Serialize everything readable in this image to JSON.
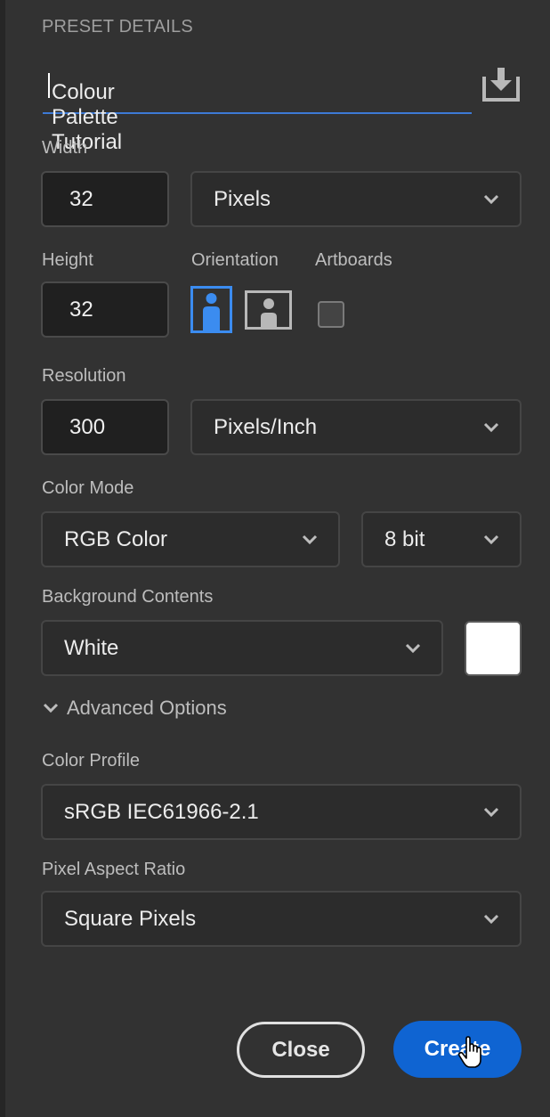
{
  "header": {
    "title": "PRESET DETAILS"
  },
  "preset_name": {
    "value": "Colour Palette Tutorial"
  },
  "icons": {
    "save_preset": "save-preset-icon",
    "portrait": "portrait-orientation-icon",
    "landscape": "landscape-orientation-icon",
    "chevron": "chevron-down-icon",
    "cursor": "hand-pointer-cursor"
  },
  "width": {
    "label": "Width",
    "value": "32",
    "unit": "Pixels"
  },
  "height": {
    "label": "Height",
    "value": "32"
  },
  "orientation": {
    "label": "Orientation",
    "selected": "portrait"
  },
  "artboards": {
    "label": "Artboards",
    "checked": false
  },
  "resolution": {
    "label": "Resolution",
    "value": "300",
    "unit": "Pixels/Inch"
  },
  "color_mode": {
    "label": "Color Mode",
    "mode": "RGB Color",
    "depth": "8 bit"
  },
  "background": {
    "label": "Background Contents",
    "value": "White",
    "swatch_color": "#ffffff"
  },
  "advanced": {
    "label": "Advanced Options",
    "expanded": true
  },
  "color_profile": {
    "label": "Color Profile",
    "value": "sRGB IEC61966-2.1"
  },
  "pixel_aspect": {
    "label": "Pixel Aspect Ratio",
    "value": "Square Pixels"
  },
  "buttons": {
    "close": "Close",
    "create": "Create"
  },
  "colors": {
    "accent": "#0f64d2",
    "focus_underline": "#3d7ad6",
    "selected_orientation": "#3b8cf0"
  }
}
